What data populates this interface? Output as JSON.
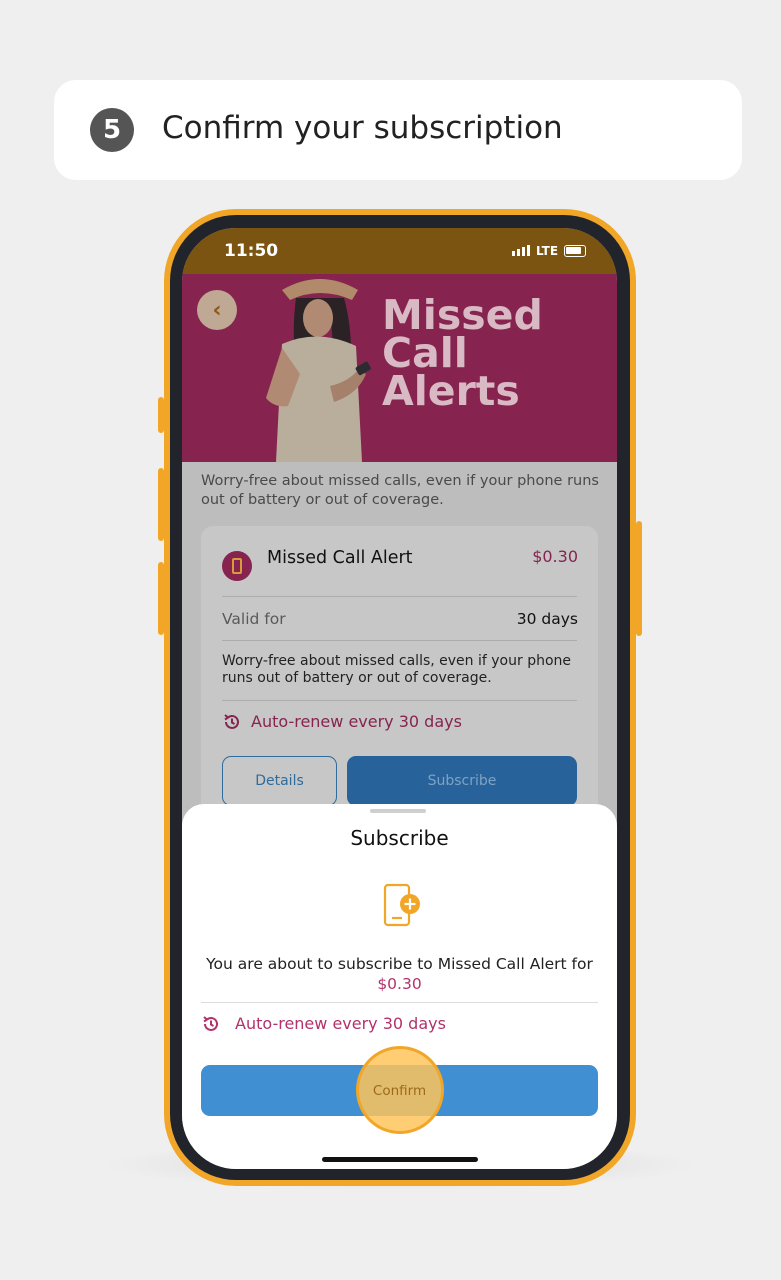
{
  "step": {
    "number": "5",
    "title": "Confirm your subscription"
  },
  "status_bar": {
    "time": "11:50",
    "network": "LTE"
  },
  "banner": {
    "title_lines": [
      "Missed",
      "Call",
      "Alerts"
    ]
  },
  "page": {
    "description": "Worry-free about missed calls, even if your phone runs out of battery or out of coverage."
  },
  "plan_card": {
    "name": "Missed Call Alert",
    "price": "$0.30",
    "valid_label": "Valid for",
    "valid_value": "30 days",
    "description": "Worry-free about missed calls, even if your phone runs out of battery or out of coverage.",
    "renew_text": "Auto-renew every 30 days",
    "details_label": "Details",
    "subscribe_label": "Subscribe"
  },
  "sheet": {
    "title": "Subscribe",
    "message": "You are about to subscribe to Missed Call Alert for",
    "price": "$0.30",
    "renew_text": "Auto-renew every 30 days",
    "confirm_label": "Confirm"
  },
  "colors": {
    "accent": "#f2a627",
    "brand_magenta": "#86244f",
    "price_pink": "#b2326b",
    "button_blue": "#418fd3"
  }
}
